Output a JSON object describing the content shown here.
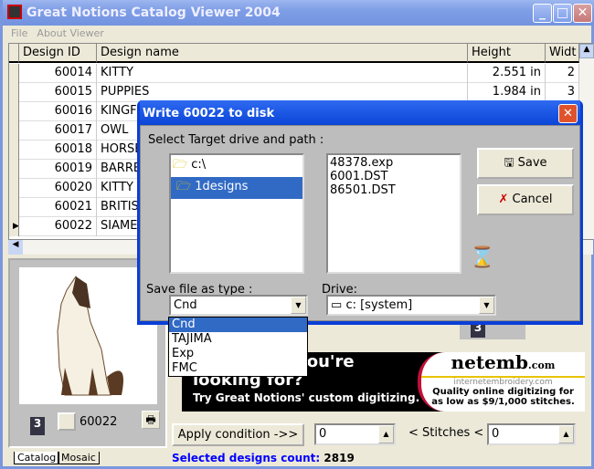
{
  "window": {
    "title": "Great Notions Catalog Viewer 2004"
  },
  "menu": [
    "File",
    "About Viewer"
  ],
  "grid": {
    "columns": [
      "Design ID",
      "Design name",
      "Height",
      "Widt"
    ],
    "rows": [
      {
        "id": "60014",
        "name": "KITTY",
        "height": "2.551 in",
        "width": "2"
      },
      {
        "id": "60015",
        "name": "PUPPIES",
        "height": "1.984 in",
        "width": "3"
      },
      {
        "id": "60016",
        "name": "KINGFI",
        "height": "",
        "width": ""
      },
      {
        "id": "60017",
        "name": "OWL",
        "height": "",
        "width": ""
      },
      {
        "id": "60018",
        "name": "HORSE",
        "height": "",
        "width": ""
      },
      {
        "id": "60019",
        "name": "BARRE",
        "height": "",
        "width": ""
      },
      {
        "id": "60020",
        "name": "KITTY ",
        "height": "",
        "width": ""
      },
      {
        "id": "60021",
        "name": "BRITIS",
        "height": "",
        "width": ""
      },
      {
        "id": "60022",
        "name": "SIAMES",
        "height": "",
        "width": ""
      }
    ],
    "current_row": "60022"
  },
  "preview": {
    "design_id": "60022",
    "badge": "3"
  },
  "ad": {
    "line1": "at you're",
    "line2": "looking for?",
    "line3": "Try Great Notions' custom digitizing.",
    "brand": "netemb",
    "brand_suffix": ".com",
    "site": "internetembroidery.com",
    "tag1": "Quality online digitizing for",
    "tag2": "as low as $9/1,000 stitches."
  },
  "filter": {
    "apply_label": "Apply condition ->>",
    "min": "0",
    "stitches_label": "< Stitches <",
    "max": "0"
  },
  "tabs": [
    "Catalog",
    "Mosaic"
  ],
  "status": {
    "label": "Selected designs count:",
    "count": "2819"
  },
  "dialog": {
    "title": "Write 60022 to disk",
    "target_label": "Select Target drive and path :",
    "folders": [
      "c:\\",
      "1designs"
    ],
    "files": [
      "48378.exp",
      "6001.DST",
      "86501.DST"
    ],
    "save_label": "Save",
    "cancel_label": "Cancel",
    "type_label": "Save file as type :",
    "type_value": "Cnd",
    "type_options": [
      "Cnd",
      "TAJIMA",
      "Exp",
      "FMC"
    ],
    "drive_label": "Drive:",
    "drive_value": "c: [system]"
  },
  "colors": {
    "selection": "#316ac5",
    "titlebar": "#0a45d6",
    "status_text": "#0000ff"
  }
}
